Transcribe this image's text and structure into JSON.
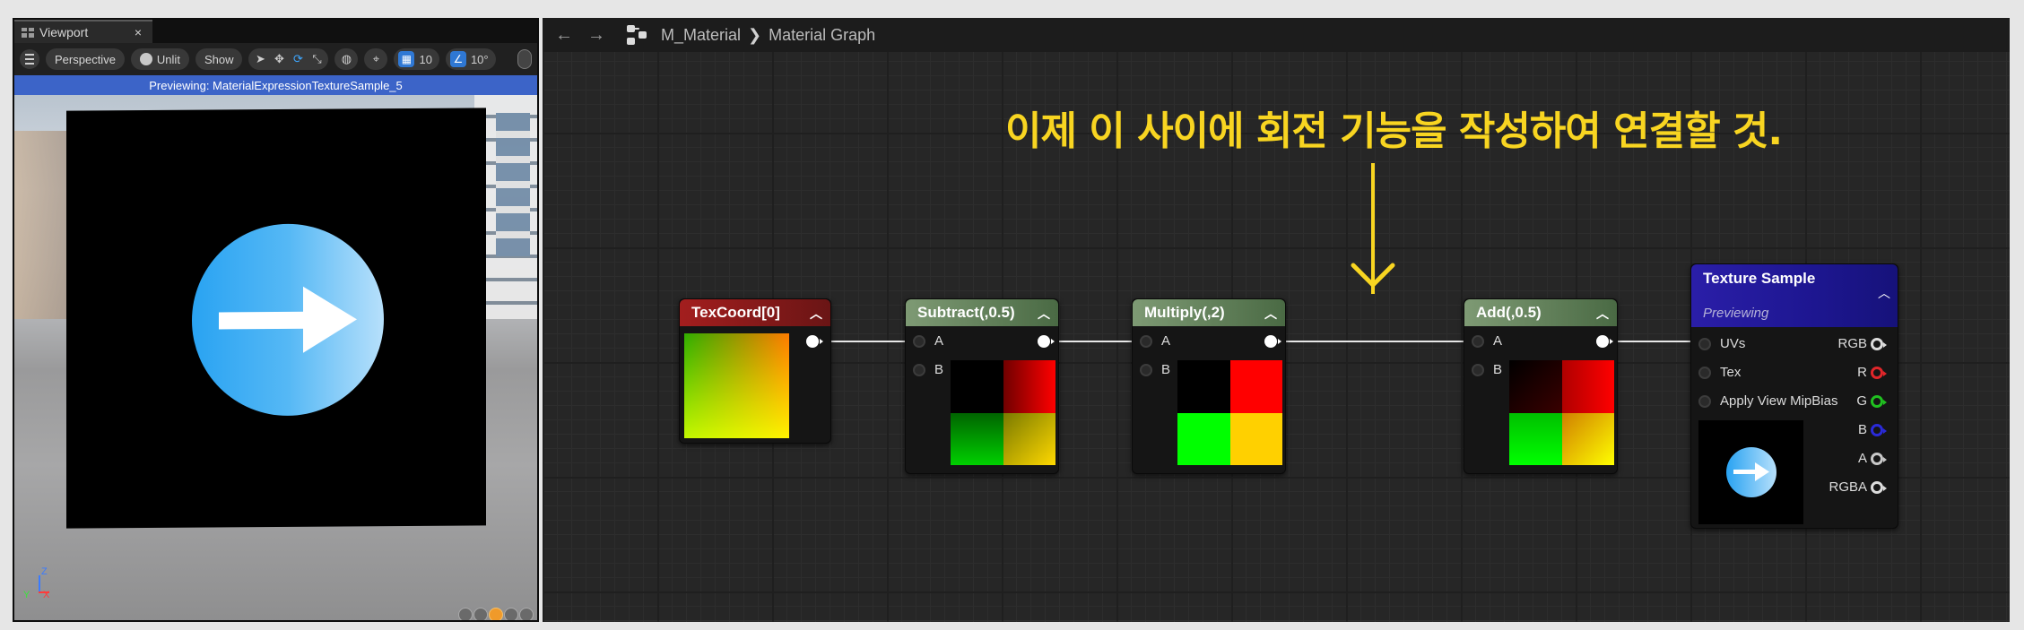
{
  "viewport": {
    "tab_label": "Viewport",
    "close_glyph": "×",
    "toolbar": {
      "perspective": "Perspective",
      "unlit": "Unlit",
      "show": "Show",
      "grid_snap": "10",
      "rot_snap": "10°"
    },
    "preview_text": "Previewing: MaterialExpressionTextureSample_5",
    "axis": {
      "z": "Z",
      "x": "X",
      "y": "Y"
    }
  },
  "graph": {
    "breadcrumb": {
      "asset": "M_Material",
      "separator": "❯",
      "page": "Material Graph"
    },
    "annotation": "이제 이 사이에 회전 기능을 작성하여 연결할 것.",
    "annotation_color": "#f8d521",
    "nodes": {
      "texcoord": {
        "title": "TexCoord[0]"
      },
      "subtract": {
        "title": "Subtract(,0.5)",
        "in_a": "A",
        "in_b": "B"
      },
      "multiply": {
        "title": "Multiply(,2)",
        "in_a": "A",
        "in_b": "B"
      },
      "add": {
        "title": "Add(,0.5)",
        "in_a": "A",
        "in_b": "B"
      },
      "texture_sample": {
        "title": "Texture Sample",
        "subtitle": "Previewing",
        "inputs": [
          "UVs",
          "Tex",
          "Apply View MipBias"
        ],
        "outputs": [
          {
            "label": "RGB",
            "color": "#dcdcdc"
          },
          {
            "label": "R",
            "color": "#e0262a"
          },
          {
            "label": "G",
            "color": "#20c020"
          },
          {
            "label": "B",
            "color": "#2a2ad8"
          },
          {
            "label": "A",
            "color": "#c8c8c8"
          },
          {
            "label": "RGBA",
            "color": "#dcdcdc"
          }
        ]
      }
    }
  }
}
